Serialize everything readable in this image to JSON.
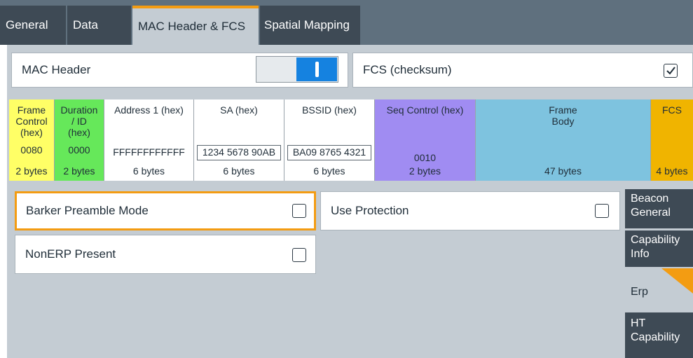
{
  "tabs": [
    {
      "label": "General",
      "active": false
    },
    {
      "label": "Data",
      "active": false
    },
    {
      "label": "MAC Header & FCS",
      "active": true
    },
    {
      "label": "Spatial Mapping",
      "active": false
    }
  ],
  "mac_header": {
    "label": "MAC Header",
    "toggle_on": true
  },
  "fcs_checksum": {
    "label": "FCS (checksum)",
    "checked": true
  },
  "frame_fields": {
    "frame_control": {
      "header": [
        "Frame",
        "Control",
        "(hex)"
      ],
      "value": "0080",
      "length": "2 bytes",
      "color": "#ffff66"
    },
    "duration_id": {
      "header": [
        "Duration",
        "/ ID",
        "(hex)"
      ],
      "value": "0000",
      "length": "2 bytes",
      "color": "#66e85a"
    },
    "address1": {
      "header": "Address 1 (hex)",
      "value": "FFFFFFFFFFFF",
      "length": "6 bytes"
    },
    "sa": {
      "header": "SA (hex)",
      "value": "1234 5678 90AB",
      "length": "6 bytes"
    },
    "bssid": {
      "header": "BSSID (hex)",
      "value": "BA09 8765 4321",
      "length": "6 bytes"
    },
    "seq_control": {
      "header": "Seq Control (hex)",
      "value": "0010",
      "length": "2 bytes",
      "color": "#a08cf2"
    },
    "frame_body": {
      "header": [
        "Frame",
        "Body"
      ],
      "length": "47 bytes",
      "color": "#7ec3df"
    },
    "fcs": {
      "header": "FCS",
      "length": "4 bytes",
      "color": "#f0b400"
    }
  },
  "erp_options": {
    "barker_preamble_mode": {
      "label": "Barker Preamble Mode",
      "checked": false
    },
    "use_protection": {
      "label": "Use Protection",
      "checked": false
    },
    "nonerp_present": {
      "label": "NonERP Present",
      "checked": false
    }
  },
  "side_tabs": [
    {
      "label": [
        "Beacon",
        "General"
      ],
      "active": false
    },
    {
      "label": [
        "Capability",
        "Info"
      ],
      "active": false
    },
    {
      "label": [
        "Erp"
      ],
      "active": true
    },
    {
      "label": [
        "HT",
        "Capability"
      ],
      "active": false
    }
  ],
  "colors": {
    "accent": "#f39c12",
    "toggle_on": "#1582e0",
    "tab_dark": "#3e4a55",
    "panel": "#c4ccd3"
  }
}
